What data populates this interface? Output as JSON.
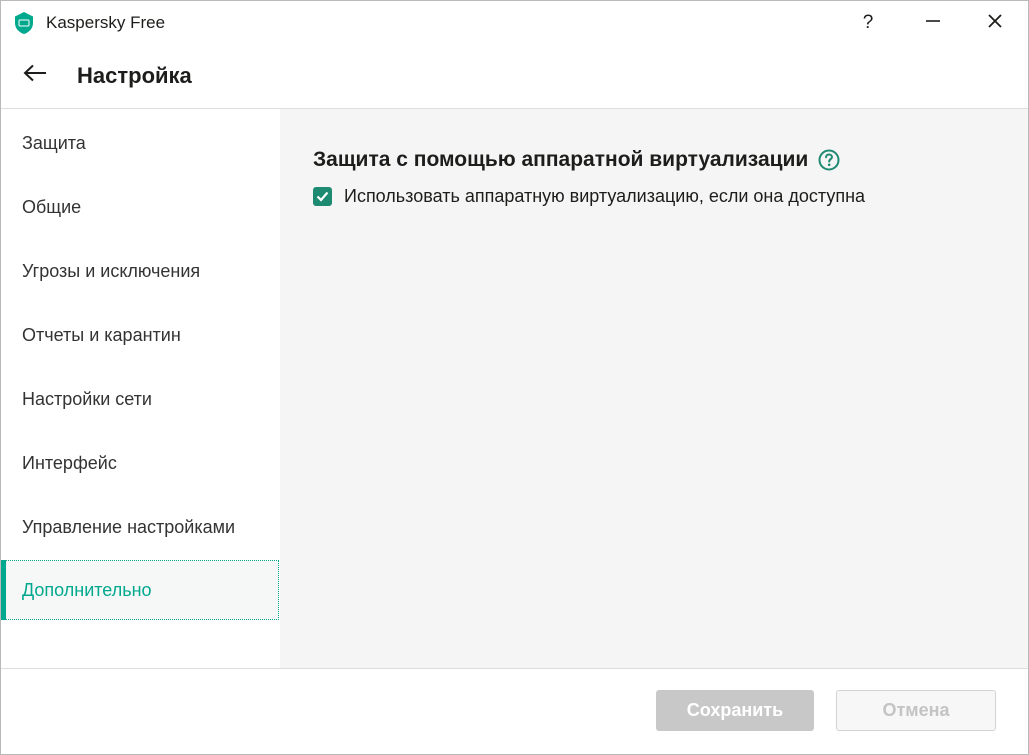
{
  "window": {
    "app_title": "Kaspersky Free",
    "help_label": "?",
    "logo_icon": "kaspersky-shield-icon"
  },
  "header": {
    "title": "Настройка",
    "back_icon": "arrow-left-icon"
  },
  "sidebar": {
    "items": [
      {
        "label": "Защита",
        "active": false
      },
      {
        "label": "Общие",
        "active": false
      },
      {
        "label": "Угрозы и исключения",
        "active": false
      },
      {
        "label": "Отчеты и карантин",
        "active": false
      },
      {
        "label": "Настройки сети",
        "active": false
      },
      {
        "label": "Интерфейс",
        "active": false
      },
      {
        "label": "Управление настройками",
        "active": false
      },
      {
        "label": "Дополнительно",
        "active": true
      }
    ]
  },
  "main": {
    "section_title": "Защита с помощью аппаратной виртуализации",
    "option": {
      "label": "Использовать аппаратную виртуализацию, если она доступна",
      "checked": true
    }
  },
  "footer": {
    "save_label": "Сохранить",
    "cancel_label": "Отмена",
    "save_enabled": false,
    "cancel_enabled": false
  },
  "colors": {
    "accent": "#00a88e",
    "checkbox": "#1e8a72",
    "content_bg": "#f5f5f5"
  }
}
